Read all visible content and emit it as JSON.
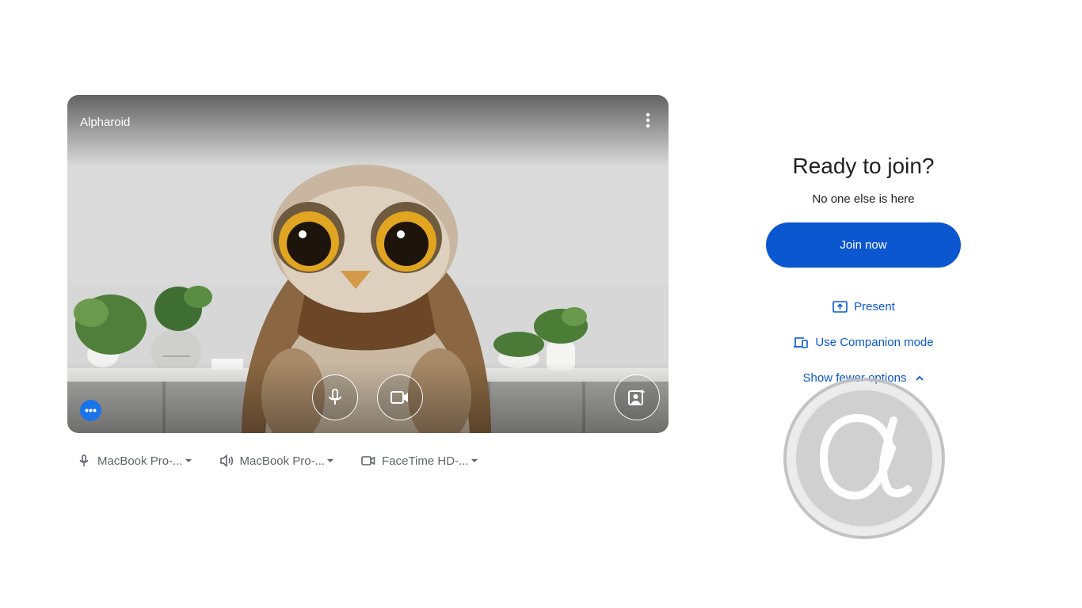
{
  "preview": {
    "participant_name": "Alpharoid",
    "more_options_icon": "more-vert-icon",
    "mic_icon": "microphone-icon",
    "camera_icon": "video-camera-icon",
    "effects_icon": "portrait-sparkle-icon",
    "visual_effects_icon": "more-horiz-icon",
    "accent_color": "#1a73e8"
  },
  "devices": {
    "microphone": {
      "label": "MacBook Pro-...",
      "icon": "microphone-icon"
    },
    "speaker": {
      "label": "MacBook Pro-...",
      "icon": "speaker-icon"
    },
    "camera": {
      "label": "FaceTime HD-...",
      "icon": "video-camera-icon"
    }
  },
  "join_panel": {
    "title": "Ready to join?",
    "subtitle": "No one else is here",
    "join_button": "Join now",
    "present_label": "Present",
    "present_icon": "present-screen-icon",
    "companion_label": "Use Companion mode",
    "companion_icon": "companion-devices-icon",
    "show_fewer_label": "Show fewer options",
    "show_fewer_icon": "chevron-up-icon",
    "primary_color": "#0b57d0"
  },
  "watermark": {
    "icon": "alpha-logo-watermark"
  }
}
